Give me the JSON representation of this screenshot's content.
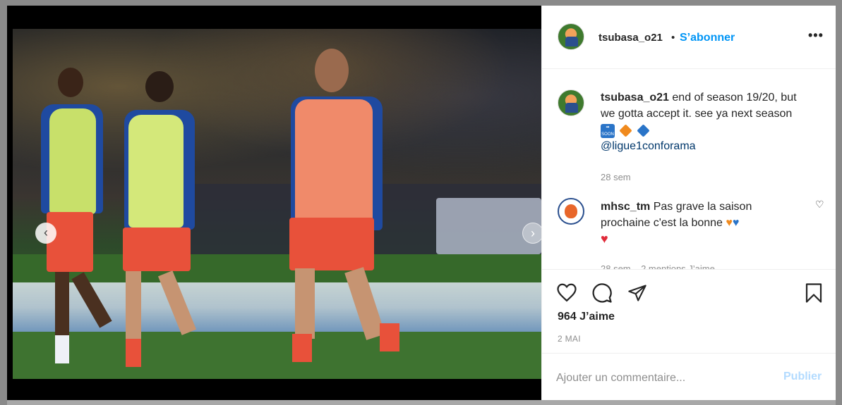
{
  "post": {
    "username": "tsubasa_o21",
    "separator": "•",
    "follow_label": "S’abonner",
    "more_icon": "more-options-icon",
    "media": {
      "prev_icon": "chevron-left-icon",
      "next_icon": "chevron-right-icon"
    }
  },
  "comments": [
    {
      "user": "tsubasa_o21",
      "text": "end of season 19/20, but we gotta accept it. see ya next season",
      "emojis": [
        "soon-arrow-emoji",
        "orange-diamond-emoji",
        "blue-diamond-emoji"
      ],
      "mention": "@ligue1conforama",
      "time": "28 sem"
    },
    {
      "user": "mhsc_tm",
      "text": "Pas grave la saison prochaine c'est la bonne",
      "emojis": [
        "orange-heart-emoji",
        "blue-heart-emoji",
        "red-heart-emoji"
      ],
      "meta": "28 sem    2 mentions J’aime"
    }
  ],
  "actions": {
    "likes": "964 J’aime",
    "date": "2 MAI"
  },
  "add_comment": {
    "placeholder": "Ajouter un commentaire...",
    "publish_label": "Publier"
  },
  "colors": {
    "accent": "#0095f6",
    "publish_disabled": "#b3dbff",
    "text": "#262626",
    "muted": "#8e8e8e"
  }
}
